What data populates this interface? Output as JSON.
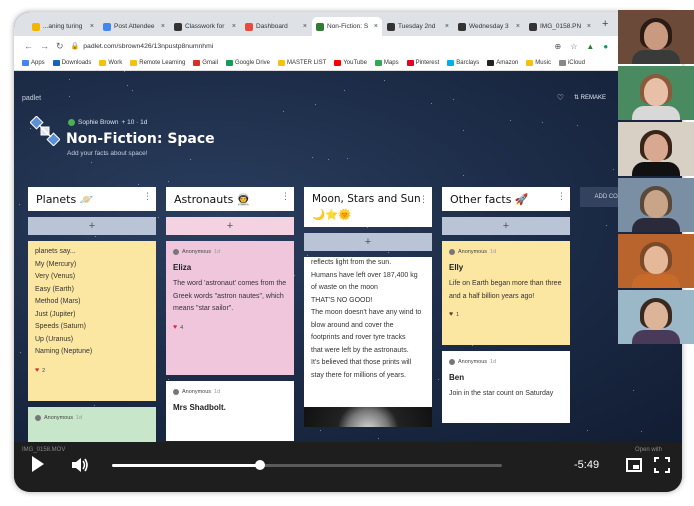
{
  "browser": {
    "tabs": [
      {
        "label": "...aning turing",
        "color": "#f4b400"
      },
      {
        "label": "Post Attendee",
        "color": "#4285f4"
      },
      {
        "label": "Classwork for",
        "color": "#333333"
      },
      {
        "label": "Dashboard",
        "color": "#e84b3c"
      },
      {
        "label": "Non-Fiction: S",
        "color": "#2e7d32",
        "active": true
      },
      {
        "label": "Tuesday 2nd",
        "color": "#333333"
      },
      {
        "label": "Wednesday 3",
        "color": "#333333"
      },
      {
        "label": "IMG_0158.PN",
        "color": "#333333"
      }
    ],
    "new_tab": "+",
    "url": "padlet.com/sbrown426/13npustp8numnhmi",
    "bookmarks": [
      {
        "label": "Apps",
        "color": "#4285f4"
      },
      {
        "label": "Downloads",
        "color": "#1565c0"
      },
      {
        "label": "Work",
        "color": "#f4c20d"
      },
      {
        "label": "Remote Learning",
        "color": "#f4c20d"
      },
      {
        "label": "Gmail",
        "color": "#d93025"
      },
      {
        "label": "Google Drive",
        "color": "#0f9d58"
      },
      {
        "label": "MASTER LIST",
        "color": "#f4c20d"
      },
      {
        "label": "YouTube",
        "color": "#ff0000"
      },
      {
        "label": "Maps",
        "color": "#34a853"
      },
      {
        "label": "Pinterest",
        "color": "#e60023"
      },
      {
        "label": "Barclays",
        "color": "#00aeef"
      },
      {
        "label": "Amazon",
        "color": "#222222"
      },
      {
        "label": "Music",
        "color": "#f4c20d"
      },
      {
        "label": "iCloud",
        "color": "#888888"
      }
    ]
  },
  "padlet": {
    "brand": "padlet",
    "remake_label": "REMAKE",
    "author": "Sophie Brown",
    "author_meta": "+ 10 · 1d",
    "title": "Non-Fiction: Space",
    "subtitle": "Add your facts about space!",
    "add_column": "ADD COLU",
    "columns": [
      {
        "title": "Planets 🪐",
        "plus": "+",
        "cards": [
          {
            "lines": [
              "planets say...",
              "My (Mercury)",
              "Very (Venus)",
              "Easy (Earth)",
              "Method (Mars)",
              "Just (Jupiter)",
              "Speeds (Saturn)",
              "Up (Uranus)",
              "Naming (Neptune)"
            ],
            "likes": "2"
          },
          {
            "author": "Anonymous",
            "time": "1d"
          }
        ]
      },
      {
        "title": "Astronauts 👨‍🚀",
        "plus": "+",
        "cards": [
          {
            "author": "Anonymous",
            "time": "1d",
            "title": "Eliza",
            "body": "The word 'astronaut' comes from the Greek words \"astron nautes\", which means \"star sailor\".",
            "likes": "4"
          },
          {
            "author": "Anonymous",
            "time": "1d",
            "title": "Mrs Shadbolt."
          }
        ]
      },
      {
        "title": "Moon, Stars and Sun 🌙⭐🌞",
        "plus": "+",
        "cards": [
          {
            "lines": [
              "reflects light from the sun.",
              "Humans have left over 187,400 kg",
              "of waste on the moon",
              "THAT'S NO GOOD!",
              "The moon doesn't have any wind to",
              "blow around and cover the",
              "footprints and rover tyre tracks",
              "that were left by the astronauts.",
              "It's believed that those prints will",
              "stay there for millions of years."
            ]
          }
        ]
      },
      {
        "title": "Other facts 🚀",
        "plus": "+",
        "cards": [
          {
            "author": "Anonymous",
            "time": "1d",
            "title": "Elly",
            "body": "Life on Earth began more than three and a half billion years ago!",
            "likes": "1"
          },
          {
            "author": "Anonymous",
            "time": "1d",
            "title": "Ben",
            "body": "Join in the star count on Saturday"
          }
        ]
      }
    ]
  },
  "video": {
    "filename": "IMG_0158.MOV",
    "drive_label": "Open with",
    "progress": 0.38,
    "time_remaining": "-5:49"
  },
  "participants": [
    {
      "bg": "#6b4a3a",
      "hair": "#2b1b14",
      "skin": "#c99a80",
      "shirt": "#3a3a3a"
    },
    {
      "bg": "#4a8a60",
      "hair": "#8a5a3a",
      "skin": "#e8c0a8",
      "shirt": "#d8d8d8"
    },
    {
      "bg": "#d8d0c4",
      "hair": "#3a2418",
      "skin": "#d8a890",
      "shirt": "#111111"
    },
    {
      "bg": "#7a8fa4",
      "hair": "#5a4838",
      "skin": "#c8a488",
      "shirt": "#2a2a3a"
    },
    {
      "bg": "#b8642c",
      "hair": "#7a4a2a",
      "skin": "#e4b898",
      "shirt": "#c86a2a"
    },
    {
      "bg": "#9ab8c8",
      "hair": "#3a2a1e",
      "skin": "#dcb49a",
      "shirt": "#4a3a5a"
    }
  ]
}
